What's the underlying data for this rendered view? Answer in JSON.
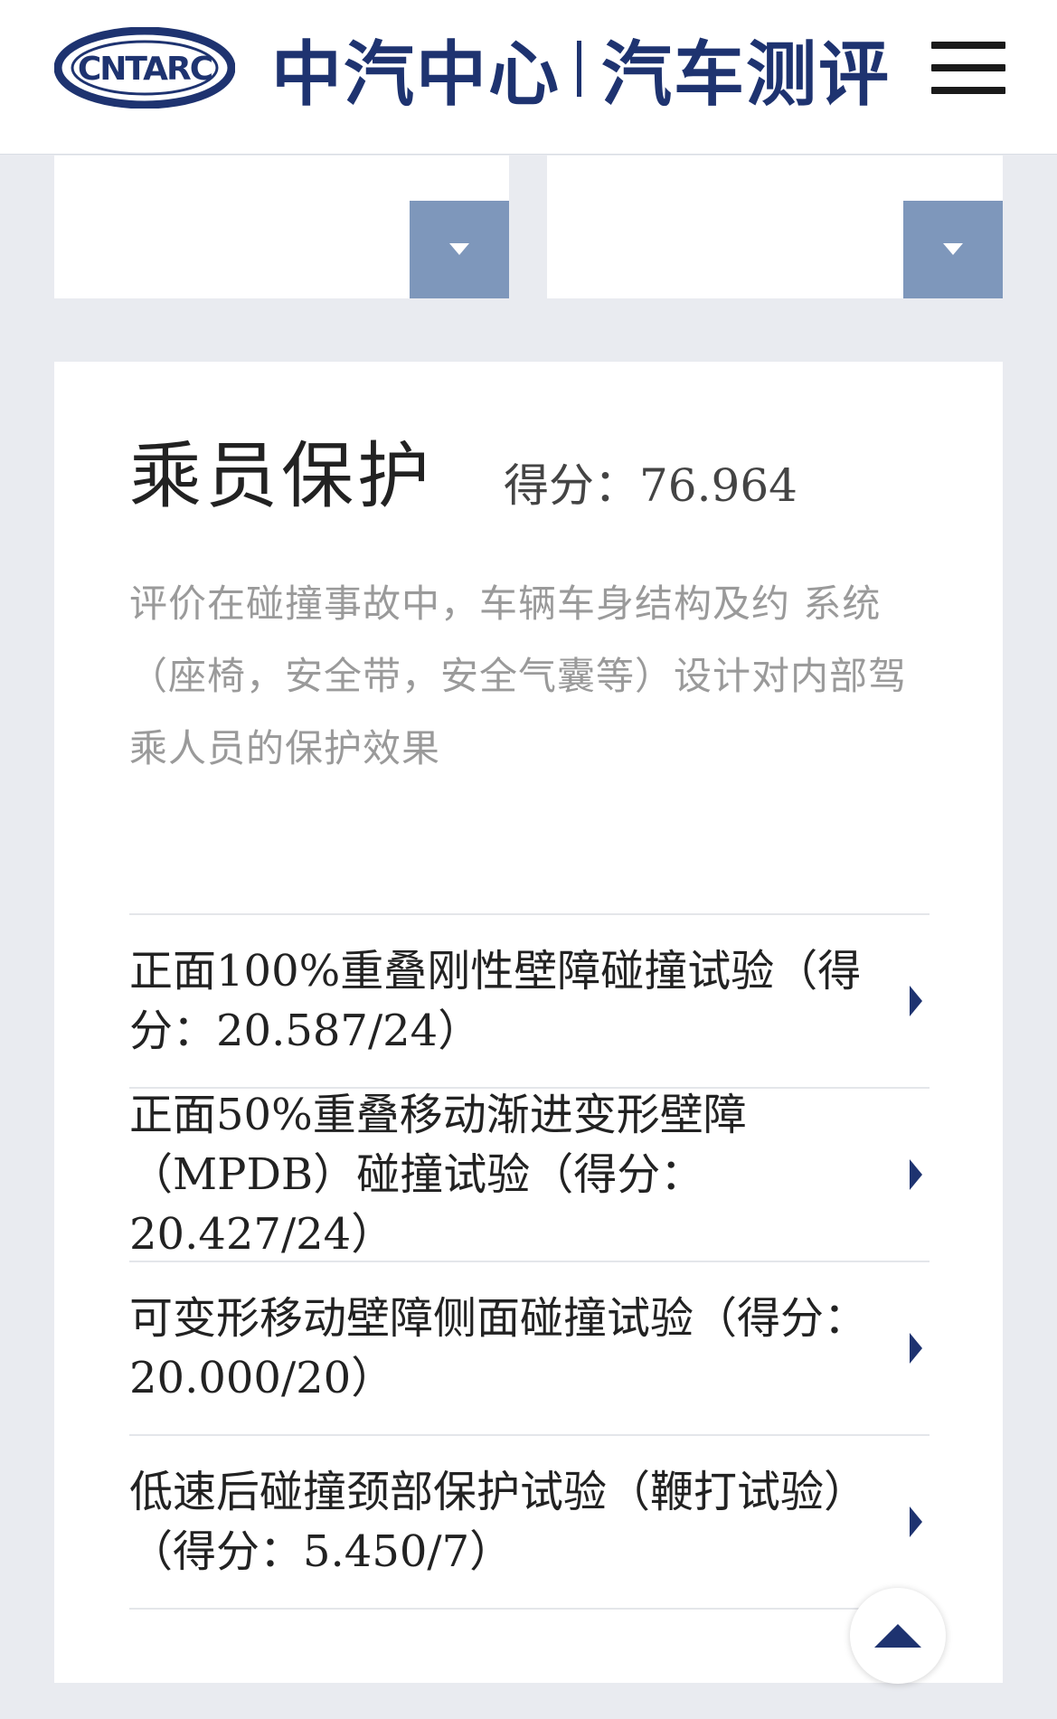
{
  "header": {
    "logo_text": "CNTARC",
    "brand_left": "中汽中心",
    "brand_right": "汽车测评",
    "brand_color": "#1e3370",
    "menu_icon": "hamburger-menu-icon"
  },
  "filters": [
    {
      "value": "",
      "icon": "caret-down-icon",
      "accent": "#7e97bb"
    },
    {
      "value": "",
      "icon": "caret-down-icon",
      "accent": "#7e97bb"
    }
  ],
  "section": {
    "title": "乘员保护",
    "score_label": "得分：",
    "score_value": "76.964",
    "description": "评价在碰撞事故中，车辆车身结构及约 系统（座椅，安全带，安全气囊等）设计对内部驾乘人员的保护效果",
    "tests": [
      {
        "label": "正面100%重叠刚性壁障碰撞试验（得分：20.587/24）",
        "icon": "chevron-right-icon"
      },
      {
        "label": "正面50%重叠移动渐进变形壁障（MPDB）碰撞试验（得分：20.427/24）",
        "icon": "chevron-right-icon"
      },
      {
        "label": "可变形移动壁障侧面碰撞试验（得分：20.000/20）",
        "icon": "chevron-right-icon"
      },
      {
        "label": "低速后碰撞颈部保护试验（鞭打试验）（得分：5.450/7）",
        "icon": "chevron-right-icon"
      }
    ]
  },
  "back_to_top": {
    "icon": "arrow-up-icon"
  }
}
